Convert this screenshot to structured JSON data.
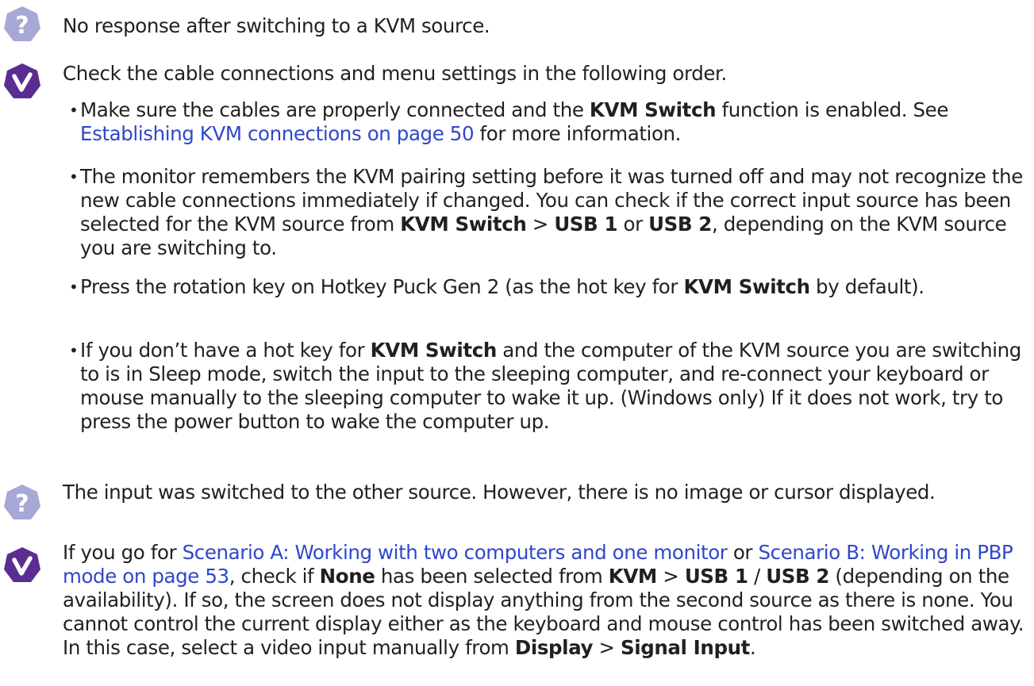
{
  "colors": {
    "question_icon": "#a7a8d6",
    "answer_icon": "#5b2c91",
    "link": "#2f47c9",
    "text": "#231f20"
  },
  "icons": {
    "question": "question-mark-icon",
    "answer": "checkmark-icon"
  },
  "section1": {
    "question": "No response after switching to a KVM source.",
    "intro": "Check the cable connections and menu settings in the following order.",
    "bullet1": {
      "a": "Make sure the cables are properly connected and the ",
      "b": "KVM Switch",
      "c": " function is enabled. See ",
      "link": "Establishing KVM connections on page 50",
      "d": " for more information."
    },
    "bullet2": {
      "a": "The monitor remembers the KVM pairing setting before it was turned off and may not recognize the new cable connections immediately if changed. You can check if the correct input source has been selected for the KVM source from ",
      "b": "KVM Switch",
      "c": " > ",
      "d": "USB 1",
      "e": " or ",
      "f": "USB 2",
      "g": ", depending on the KVM source you are switching to."
    },
    "bullet3": {
      "a": "Press the rotation key on Hotkey Puck Gen 2 (as the hot key for ",
      "b": "KVM Switch",
      "c": " by default)."
    },
    "bullet4": {
      "a": "If you don’t have a hot key for ",
      "b": "KVM Switch",
      "c": " and the computer of the KVM source you are switching to is in Sleep mode, switch the input to the sleeping computer, and re-connect your keyboard or mouse manually to the sleeping computer to wake it up. (Windows only) If it does not work, try to press the power button to wake the computer up."
    }
  },
  "section2": {
    "question": "The input was switched to the other source. However, there is no image or cursor displayed.",
    "answer": {
      "a": "If you go for ",
      "link1": "Scenario A: Working with two computers and one monitor",
      "b": " or ",
      "link2": "Scenario B: Working in PBP mode on page 53",
      "c": ", check if ",
      "d": "None",
      "e": " has been selected from ",
      "f": "KVM",
      "g": " > ",
      "h": "USB 1",
      "i": " / ",
      "j": "USB 2",
      "k": " (depending on the availability). If so, the screen does not display anything from the second source as there is none. You cannot control the current display either as the keyboard and mouse control has been switched away. In this case, select a video input manually from ",
      "l": "Display",
      "m": " > ",
      "n": "Signal Input",
      "o": "."
    }
  }
}
